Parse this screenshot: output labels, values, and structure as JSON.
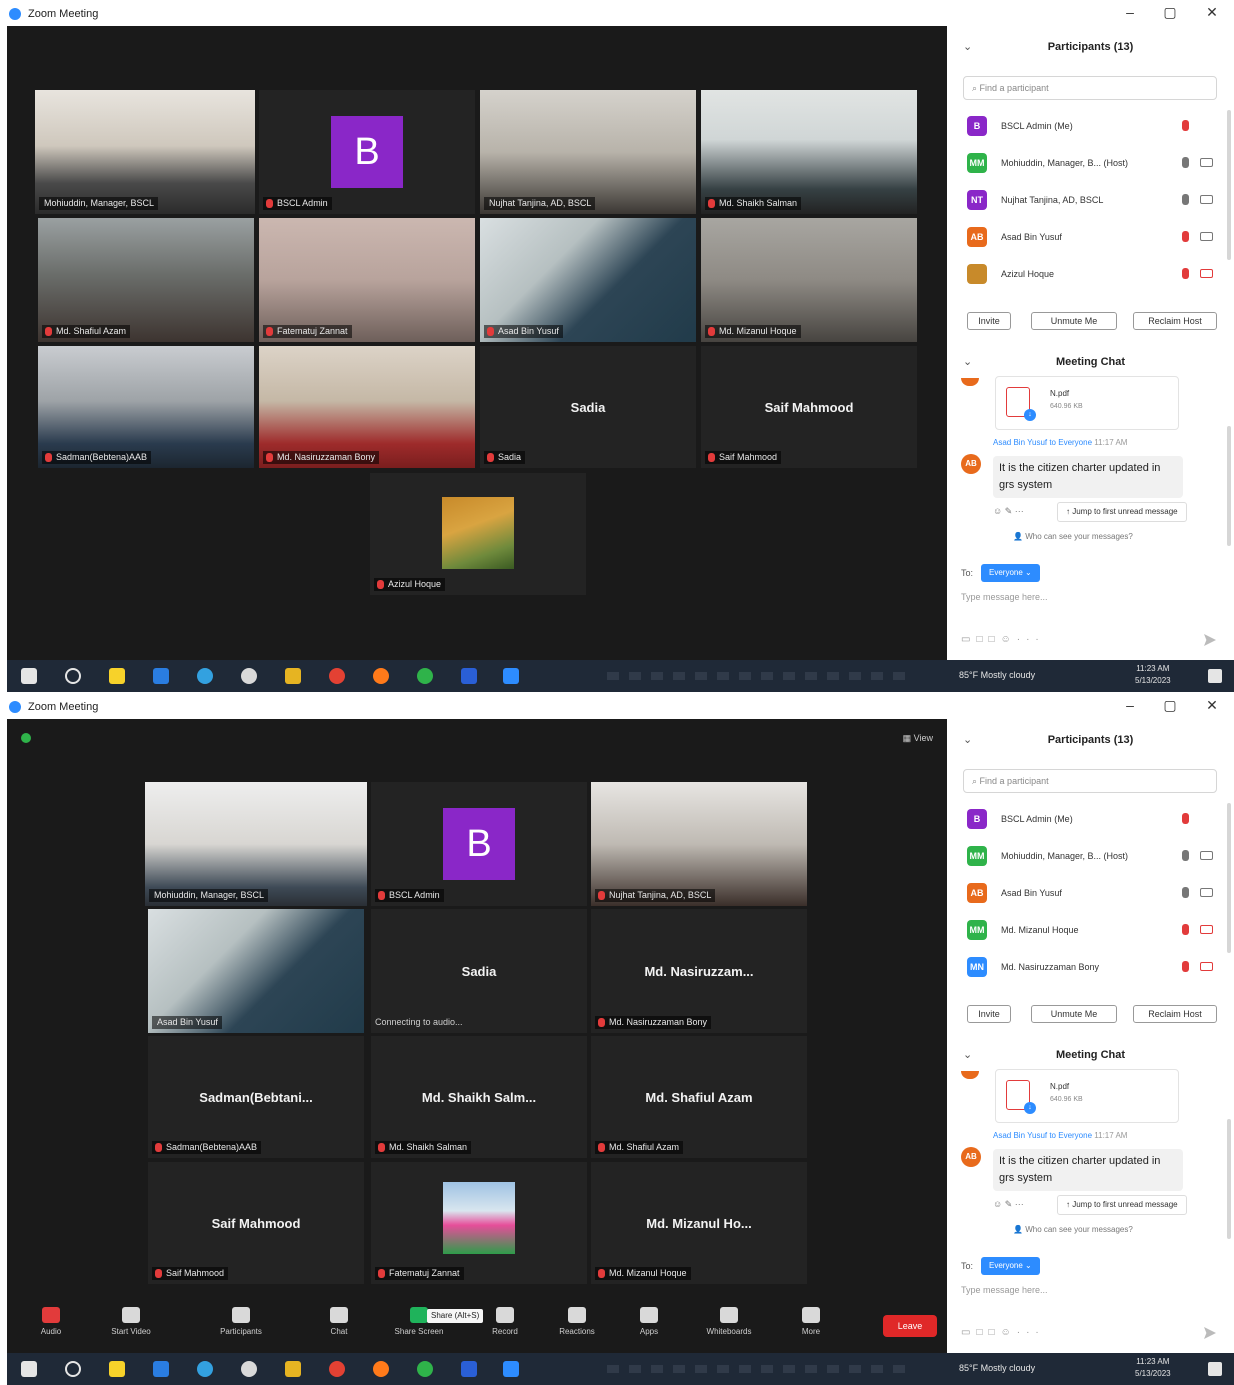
{
  "window": {
    "title": "Zoom Meeting",
    "minimize": "–",
    "maximize": "▢",
    "close": "✕"
  },
  "top": {
    "tiles": {
      "t1": "Mohiuddin, Manager, BSCL",
      "t2": "BSCL Admin",
      "t3": "Nujhat Tanjina, AD, BSCL",
      "t4": "Md. Shaikh Salman",
      "t5": "Md. Shafiul Azam",
      "t6": "Fatematuj Zannat",
      "t7": "Asad Bin Yusuf",
      "t8": "Md. Mizanul Hoque",
      "t9": "Sadman(Bebtena)AAB",
      "t10": "Md. Nasiruzzaman Bony",
      "t11": "Sadia",
      "t11_big": "Sadia",
      "t12": "Saif Mahmood",
      "t12_big": "Saif Mahmood",
      "t13": "Azizul Hoque"
    },
    "panel": {
      "participants_title": "Participants (13)",
      "search_placeholder": "Find a participant",
      "participants": [
        {
          "initials": "B",
          "name": "BSCL Admin (Me)"
        },
        {
          "initials": "MM",
          "name": "Mohiuddin, Manager, B... (Host)"
        },
        {
          "initials": "NT",
          "name": "Nujhat Tanjina, AD, BSCL"
        },
        {
          "initials": "AB",
          "name": "Asad Bin Yusuf"
        },
        {
          "initials": "",
          "name": "Azizul Hoque"
        }
      ]
    }
  },
  "bottom": {
    "view_label": "View",
    "tiles": {
      "u1": "Mohiuddin, Manager, BSCL",
      "u2": "BSCL Admin",
      "u3": "Nujhat Tanjina, AD, BSCL",
      "u4": "Asad Bin Yusuf",
      "u5_big": "Sadia",
      "u5_sub": "Connecting to audio...",
      "u6_big": "Md. Nasiruzzam...",
      "u6": "Md. Nasiruzzaman Bony",
      "u7_big": "Sadman(Bebtani...",
      "u7": "Sadman(Bebtena)AAB",
      "u8_big": "Md. Shaikh Salm...",
      "u8": "Md. Shaikh Salman",
      "u9_big": "Md. Shafiul Azam",
      "u9": "Md. Shafiul Azam",
      "u10_big": "Saif Mahmood",
      "u10": "Saif Mahmood",
      "u11": "Fatematuj Zannat",
      "u12_big": "Md. Mizanul Ho...",
      "u12": "Md. Mizanul Hoque"
    },
    "toolbar": {
      "audio": "Audio",
      "video": "Start Video",
      "participants": "Participants",
      "participants_count": "13",
      "chat": "Chat",
      "share": "Share Screen",
      "share_tip": "Share (Alt+S)",
      "record": "Record",
      "reactions": "Reactions",
      "apps": "Apps",
      "whiteboards": "Whiteboards",
      "more": "More",
      "end": "Leave"
    },
    "panel": {
      "participants_title": "Participants (13)",
      "search_placeholder": "Find a participant",
      "participants": [
        {
          "initials": "B",
          "name": "BSCL Admin (Me)"
        },
        {
          "initials": "MM",
          "name": "Mohiuddin, Manager, B... (Host)"
        },
        {
          "initials": "AB",
          "name": "Asad Bin Yusuf"
        },
        {
          "initials": "MM",
          "name": "Md. Mizanul Hoque"
        },
        {
          "initials": "MN",
          "name": "Md. Nasiruzzaman Bony"
        }
      ]
    }
  },
  "panel_common": {
    "invite": "Invite",
    "unmute_me": "Unmute Me",
    "reclaim_host": "Reclaim Host",
    "chat_title": "Meeting Chat",
    "collapse": "⌄",
    "file_name": "N.pdf",
    "file_size": "640.96 KB",
    "msg_from": "Asad Bin Yusuf to Everyone",
    "msg_time": "11:17 AM",
    "msg_initials": "AB",
    "msg_text": "It is the citizen charter updated in grs system",
    "jump_label": "Jump to first unread message",
    "who_can_see": "Who can see your messages?",
    "to_label": "To:",
    "to_value": "Everyone ⌄",
    "input_placeholder": "Type message here..."
  },
  "taskbar": {
    "weather": "85°F  Mostly cloudy",
    "time": "11:23 AM",
    "date": "5/13/2023"
  },
  "colors": {
    "zoom_blue": "#2d8cff",
    "active_speaker": "#cfe23a",
    "avatar_purple": "#8a27c8",
    "end_red": "#e02828"
  }
}
